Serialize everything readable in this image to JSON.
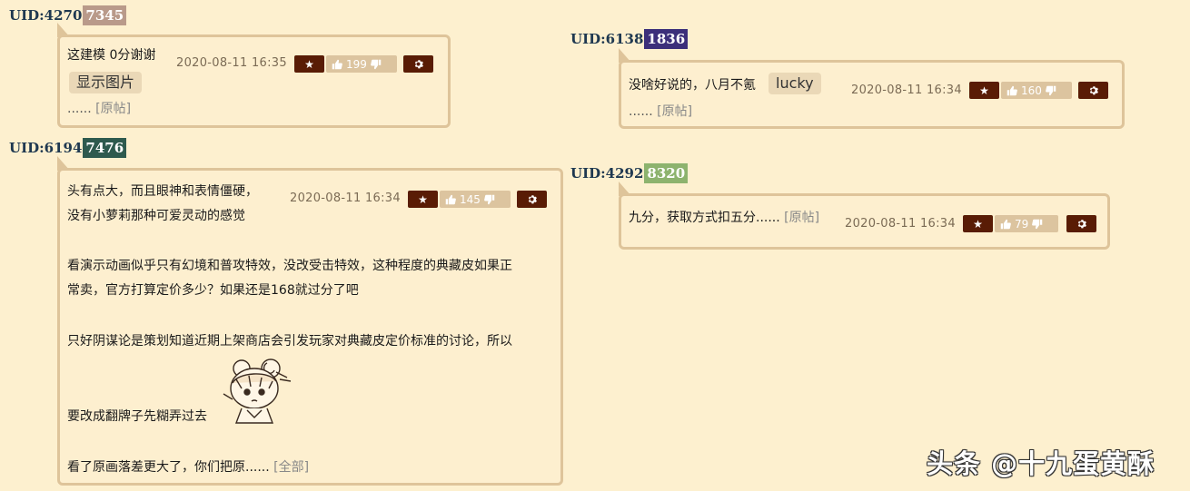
{
  "comments": [
    {
      "uid_prefix": "UID:4270",
      "uid_suffix": "7345",
      "uid_color": "#b99a8a",
      "lines": [
        "这建模 0分谢谢"
      ],
      "button": "显示图片",
      "more_text": "......",
      "more_link": "[原帖]",
      "date": "2020-08-11 16:35",
      "votes": "199"
    },
    {
      "uid_prefix": "UID:6194",
      "uid_suffix": "7476",
      "uid_color": "#2e5a4e",
      "lines": [
        "头有点大，而且眼神和表情僵硬，",
        "没有小萝莉那种可爱灵动的感觉",
        "",
        "看演示动画似乎只有幻境和普攻特效，没改受击特效，这种程度的典藏皮如果正",
        "常卖，官方打算定价多少？如果还是168就过分了吧",
        "",
        "只好阴谋论是策划知道近期上架商店会引发玩家对典藏皮定价标准的讨论，所以"
      ],
      "line_after_sticker": "要改成翻牌子先糊弄过去",
      "last_line": "看了原画落差更大了，你们把原......",
      "more_link": "[全部]",
      "date": "2020-08-11 16:34",
      "votes": "145"
    },
    {
      "uid_prefix": "UID:6138",
      "uid_suffix": "1836",
      "uid_color": "#3c2f7a",
      "lines": [
        "没啥好说的，八月不氪"
      ],
      "tag": "lucky",
      "more_text": "......",
      "more_link": "[原帖]",
      "date": "2020-08-11 16:34",
      "votes": "160"
    },
    {
      "uid_prefix": "UID:4292",
      "uid_suffix": "8320",
      "uid_color": "#8db36e",
      "lines": [
        "九分，获取方式扣五分......"
      ],
      "more_link": "[原帖]",
      "date": "2020-08-11 16:34",
      "votes": "79"
    }
  ],
  "icons": {
    "star": "star-icon",
    "thumb_up": "thumb-up-icon",
    "thumb_down": "thumb-down-icon",
    "gear": "gear-icon"
  },
  "watermark": "头条 @十九蛋黄酥"
}
